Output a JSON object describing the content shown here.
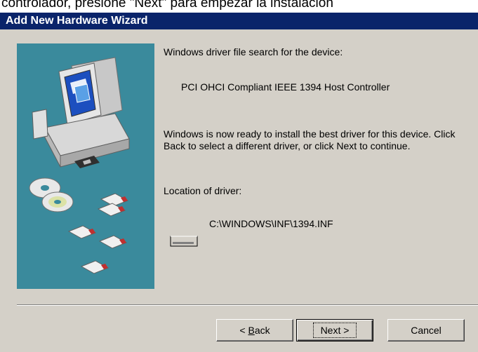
{
  "top_caption": "controlador, presione \"Next\" para empezar la instalación",
  "window": {
    "title": "Add New Hardware Wizard"
  },
  "content": {
    "search_heading": "Windows driver file search for the device:",
    "device_name": "PCI OHCI Compliant IEEE 1394 Host Controller",
    "ready_message": "Windows is now ready to install the best driver for this device. Click Back to select a different driver, or click Next to continue.",
    "location_label": "Location of driver:",
    "driver_path": "C:\\WINDOWS\\INF\\1394.INF"
  },
  "buttons": {
    "back_prefix": "< ",
    "back_accel": "B",
    "back_rest": "ack",
    "next_label": "Next >",
    "cancel_label": "Cancel"
  },
  "icons": {
    "art": "computer-with-disks-illustration",
    "drive": "hard-drive-icon"
  }
}
